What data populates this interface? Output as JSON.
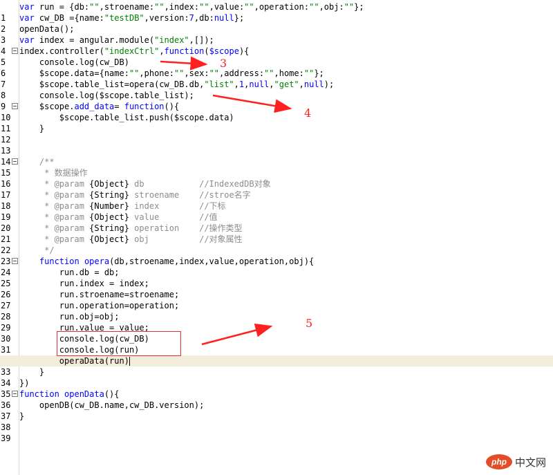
{
  "editor": {
    "lines": [
      {
        "n": "1",
        "t": "var run = {db:\"\",stroename:\"\",index:\"\",value:\"\",operation:\"\",obj:\"\"};"
      },
      {
        "n": "2",
        "t": "var cw_DB ={name:\"testDB\",version:7,db:null};"
      },
      {
        "n": "3",
        "t": "openData();"
      },
      {
        "n": "4",
        "t": "var index = angular.module(\"index\",[]);"
      },
      {
        "n": "5",
        "t": "index.controller(\"indexCtrl\",function($scope){"
      },
      {
        "n": "6",
        "t": "    console.log(cw_DB)"
      },
      {
        "n": "7",
        "t": "    $scope.data={name:\"\",phone:\"\",sex:\"\",address:\"\",home:\"\"};"
      },
      {
        "n": "8",
        "t": "    $scope.table_list=opera(cw_DB.db,\"list\",1,null,\"get\",null);"
      },
      {
        "n": "9",
        "t": "    console.log($scope.table_list);"
      },
      {
        "n": "10",
        "t": "    $scope.add_data= function(){"
      },
      {
        "n": "11",
        "t": "        $scope.table_list.push($scope.data)"
      },
      {
        "n": "12",
        "t": "    }"
      },
      {
        "n": "13",
        "t": ""
      },
      {
        "n": "14",
        "t": ""
      },
      {
        "n": "15",
        "t": "    /**"
      },
      {
        "n": "16",
        "t": "     * 数据操作"
      },
      {
        "n": "17",
        "t": "     * @param {Object} db           //IndexedDB对象"
      },
      {
        "n": "18",
        "t": "     * @param {String} stroename    //stroe名字"
      },
      {
        "n": "19",
        "t": "     * @param {Number} index        //下标"
      },
      {
        "n": "20",
        "t": "     * @param {Object} value        //值"
      },
      {
        "n": "21",
        "t": "     * @param {String} operation    //操作类型"
      },
      {
        "n": "22",
        "t": "     * @param {Object} obj          //对象属性"
      },
      {
        "n": "23",
        "t": "     */"
      },
      {
        "n": "24",
        "t": "    function opera(db,stroename,index,value,operation,obj){"
      },
      {
        "n": "25",
        "t": "        run.db = db;"
      },
      {
        "n": "26",
        "t": "        run.index = index;"
      },
      {
        "n": "27",
        "t": "        run.stroename=stroename;"
      },
      {
        "n": "28",
        "t": "        run.operation=operation;"
      },
      {
        "n": "29",
        "t": "        run.obj=obj;"
      },
      {
        "n": "30",
        "t": "        run.value = value;"
      },
      {
        "n": "31",
        "t": "        console.log(cw_DB)"
      },
      {
        "n": "32",
        "t": "        console.log(run)"
      },
      {
        "n": "33",
        "t": "        operaData(run)"
      },
      {
        "n": "34",
        "t": "    }"
      },
      {
        "n": "35",
        "t": "})"
      },
      {
        "n": "36",
        "t": "function openData(){"
      },
      {
        "n": "37",
        "t": "    openDB(cw_DB.name,cw_DB.version);"
      },
      {
        "n": "38",
        "t": "}"
      },
      {
        "n": "39",
        "t": ""
      }
    ]
  },
  "annotations": {
    "a3": "3",
    "a4": "4",
    "a5": "5"
  },
  "watermark": {
    "logo": "php",
    "text": "中文网"
  },
  "colors": {
    "keyword": "#0000ff",
    "string": "#008000",
    "comment": "#8c8c8c",
    "annotation": "#ff2020",
    "current_line": "#f3eedc"
  }
}
